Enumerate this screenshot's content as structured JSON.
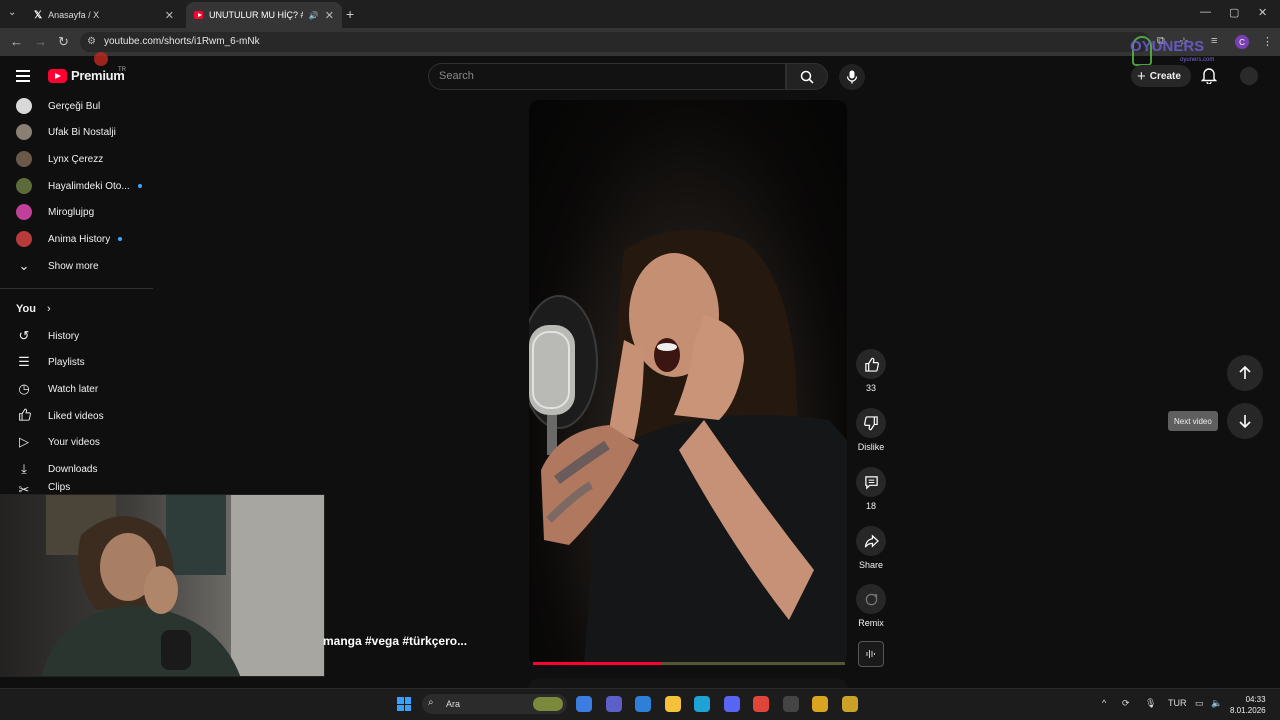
{
  "browser": {
    "tabs": [
      {
        "title": "Anasayfa / X",
        "active": false
      },
      {
        "title": "UNUTULUR MU HİÇ? #man",
        "active": true
      }
    ],
    "url": "youtube.com/shorts/i1Rwm_6-mNk",
    "profile_initial": "C",
    "window_controls": [
      "—",
      "▢",
      "✕"
    ]
  },
  "youtube": {
    "logo_text": "Premium",
    "region": "TR",
    "search_placeholder": "Search",
    "create_label": "Create",
    "watermark": "OYUNERS",
    "watermark_sub": "oyuners.com"
  },
  "sidebar": {
    "subscriptions": [
      {
        "label": "Gerçeği Bul",
        "color": "#d9d9d9",
        "new": false
      },
      {
        "label": "Ufak Bi Nostalji",
        "color": "#8a7f73",
        "new": false
      },
      {
        "label": "Lynx Çerezz",
        "color": "#6b5a4a",
        "new": false
      },
      {
        "label": "Hayalimdeki Oto...",
        "color": "#5d6b3a",
        "new": true
      },
      {
        "label": "Miroglujpg",
        "color": "#c0409a",
        "new": false
      },
      {
        "label": "Anima History",
        "color": "#b83a3a",
        "new": true
      }
    ],
    "show_more": "Show more",
    "you_header": "You",
    "you_items": [
      {
        "label": "History",
        "icon": "history-icon",
        "glyph": "↺"
      },
      {
        "label": "Playlists",
        "icon": "playlists-icon",
        "glyph": "☰"
      },
      {
        "label": "Watch later",
        "icon": "clock-icon",
        "glyph": "◷"
      },
      {
        "label": "Liked videos",
        "icon": "thumbs-up-icon",
        "glyph": "👍"
      },
      {
        "label": "Your videos",
        "icon": "play-square-icon",
        "glyph": "▷"
      },
      {
        "label": "Downloads",
        "icon": "download-icon",
        "glyph": "⤓"
      },
      {
        "label": "Clips",
        "icon": "scissors-icon",
        "glyph": "✂"
      }
    ]
  },
  "short": {
    "caption": "manga #vega #türkçero...",
    "progress_fraction": 0.41,
    "actions": {
      "like_count": "33",
      "dislike_label": "Dislike",
      "comment_count": "18",
      "share_label": "Share",
      "remix_label": "Remix"
    },
    "next_tooltip": "Next video"
  },
  "taskbar": {
    "search_label": "Ara",
    "language": "TUR",
    "time": "04:33",
    "date": "8.01.2026",
    "apps": [
      {
        "name": "copilot-app",
        "color": "#3b7de0"
      },
      {
        "name": "teams-app",
        "color": "#5b5fc7"
      },
      {
        "name": "store-app",
        "color": "#2d7fd8"
      },
      {
        "name": "explorer-app",
        "color": "#f3c13a"
      },
      {
        "name": "edge-app",
        "color": "#1fa3d6"
      },
      {
        "name": "discord-app",
        "color": "#5865f2"
      },
      {
        "name": "chrome-app",
        "color": "#e0453a"
      },
      {
        "name": "obs-app",
        "color": "#444444"
      },
      {
        "name": "app-a",
        "color": "#d9a520"
      },
      {
        "name": "app-b",
        "color": "#c9a227"
      }
    ]
  }
}
